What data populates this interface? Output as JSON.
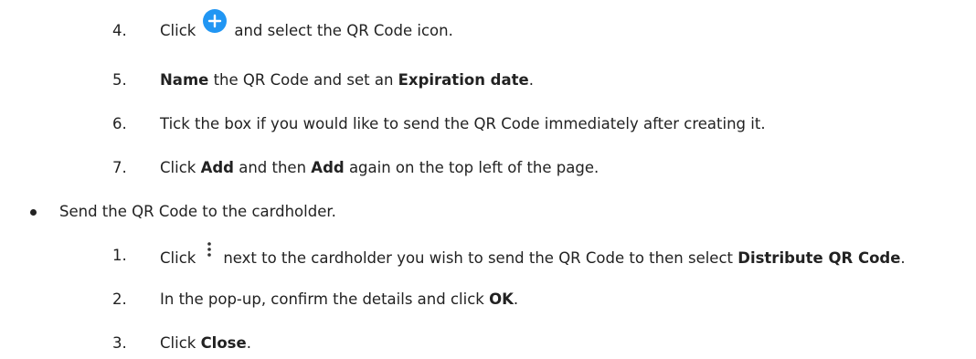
{
  "steps_add": [
    {
      "num": "4.",
      "before": "Click",
      "after": "and select the QR Code icon."
    },
    {
      "num": "5.",
      "bold1": "Name",
      "mid1": " the QR Code and set an ",
      "bold2": "Expiration date",
      "end": "."
    },
    {
      "num": "6.",
      "text": "Tick the box if you would like to send the QR Code immediately after creating it."
    },
    {
      "num": "7.",
      "pre": "Click ",
      "bold1": "Add",
      "mid1": " and then ",
      "bold2": "Add",
      "end": " again on the top left of the page."
    }
  ],
  "bullet": {
    "text": "Send the QR Code to the cardholder."
  },
  "steps_send": [
    {
      "num": "1.",
      "before": "Click",
      "after": "next to the cardholder you wish to send the QR Code to then select ",
      "bold": "Distribute QR Code",
      "end": "."
    },
    {
      "num": "2.",
      "pre": "In the pop-up, confirm the details and click ",
      "bold": "OK",
      "end": "."
    },
    {
      "num": "3.",
      "pre": "Click ",
      "bold": "Close",
      "end": "."
    }
  ],
  "colors": {
    "accent": "#2196f3",
    "text": "#222222",
    "kebab": "#333333"
  },
  "icons": {
    "add": "plus-circle-icon",
    "menu": "more-vertical-icon"
  }
}
